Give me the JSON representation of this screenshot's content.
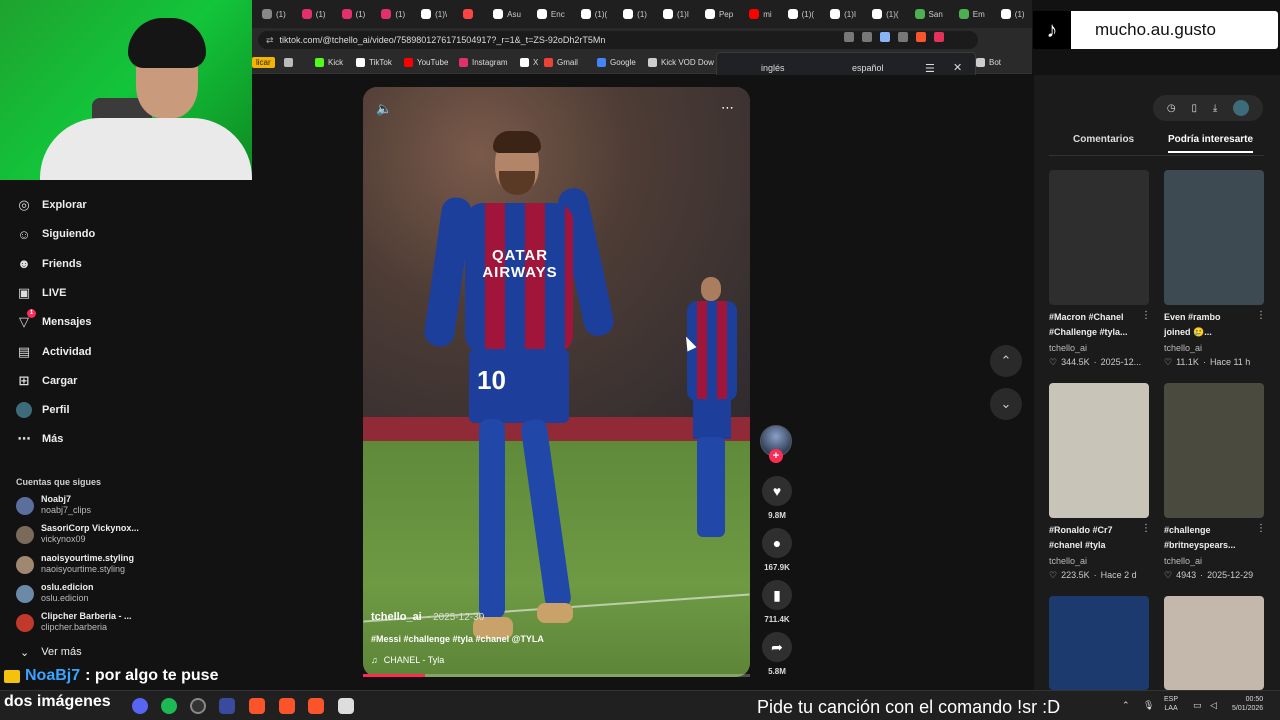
{
  "browser": {
    "tabs": [
      {
        "label": "(1)",
        "color": "#888888"
      },
      {
        "label": "(1)",
        "color": "#e1306c"
      },
      {
        "label": "(1)",
        "color": "#e1306c"
      },
      {
        "label": "(1)",
        "color": "#e1306c"
      },
      {
        "label": "(1)\\",
        "color": "#ffffff"
      },
      {
        "label": "",
        "color": "#ff4444"
      },
      {
        "label": "Asu",
        "color": "#ffffff"
      },
      {
        "label": "Enc",
        "color": "#ffffff"
      },
      {
        "label": "(1)(",
        "color": "#ffffff"
      },
      {
        "label": "(1)",
        "color": "#ffffff"
      },
      {
        "label": "(1)I",
        "color": "#ffffff"
      },
      {
        "label": "Pep",
        "color": "#ffffff"
      },
      {
        "label": "mi",
        "color": "#ff0000"
      },
      {
        "label": "(1)(",
        "color": "#ffffff"
      },
      {
        "label": "(1)I",
        "color": "#ffffff"
      },
      {
        "label": "(1)(",
        "color": "#ffffff"
      },
      {
        "label": "San",
        "color": "#4caf50"
      },
      {
        "label": "Em",
        "color": "#4caf50"
      },
      {
        "label": "(1)",
        "color": "#ffffff"
      }
    ],
    "url": "tiktok.com/@tchello_ai/video/7589801276171504917?_r=1&_t=ZS-92oDh2rT5Mn",
    "bookmarks": [
      {
        "label": "licar",
        "color": "#f5b400"
      },
      {
        "label": "",
        "color": "#bbbbbb"
      },
      {
        "label": "Kick",
        "color": "#53fc18"
      },
      {
        "label": "TikTok",
        "color": "#ffffff"
      },
      {
        "label": "YouTube",
        "color": "#ff0000"
      },
      {
        "label": "Instagram",
        "color": "#e1306c"
      },
      {
        "label": "X",
        "color": "#ffffff"
      },
      {
        "label": "Gmail",
        "color": "#ea4335"
      },
      {
        "label": "Google",
        "color": "#4285f4"
      },
      {
        "label": "Kick VOD Dow",
        "color": "#cccccc"
      },
      {
        "label": "Bot",
        "color": "#cccccc"
      }
    ],
    "translate": {
      "from": "inglés",
      "to": "español"
    }
  },
  "sidebar": {
    "nav": [
      {
        "label": "Explorar",
        "icon": "compass-icon",
        "glyph": "◎"
      },
      {
        "label": "Siguiendo",
        "icon": "following-icon",
        "glyph": "☺"
      },
      {
        "label": "Friends",
        "icon": "friends-icon",
        "glyph": "☻"
      },
      {
        "label": "LIVE",
        "icon": "live-icon",
        "glyph": "▣"
      },
      {
        "label": "Mensajes",
        "icon": "messages-icon",
        "glyph": "▽"
      },
      {
        "label": "Actividad",
        "icon": "activity-icon",
        "glyph": "▤"
      },
      {
        "label": "Cargar",
        "icon": "upload-icon",
        "glyph": "⊞"
      },
      {
        "label": "Perfil",
        "icon": "profile-icon",
        "glyph": "●"
      },
      {
        "label": "Más",
        "icon": "more-icon",
        "glyph": "⋯"
      }
    ],
    "messages_badge": "1",
    "following_header": "Cuentas que sigues",
    "accounts": [
      {
        "name": "Noabj7",
        "handle": "noabj7_clips",
        "color": "#5b6f9e"
      },
      {
        "name": "SasoriCorp Vickynox...",
        "handle": "vickynox09",
        "color": "#7a6a5a"
      },
      {
        "name": "naoisyourtime.styling",
        "handle": "naoisyourtime.styling",
        "color": "#a08870"
      },
      {
        "name": "oslu.edicion",
        "handle": "oslu.edicion",
        "color": "#6a8aa8"
      },
      {
        "name": "Clipcher Barberia - ...",
        "handle": "clipcher.barberia",
        "color": "#c0392b"
      }
    ],
    "see_more": "Ver más"
  },
  "video": {
    "username": "tchello_ai",
    "date": "· 2025-12-30",
    "tags": "#Messi #challenge #tyla #chanel @TYLA",
    "sound": "CHANEL - Tyla",
    "sponsor": "QATAR AIRWAYS",
    "number": "10",
    "progress_pct": 16
  },
  "actions": {
    "likes": "9.8M",
    "comments": "167.9K",
    "saves": "711.4K",
    "shares": "5.8M"
  },
  "right_panel": {
    "tabs": [
      "Comentarios",
      "Podría interesarte"
    ],
    "cards": [
      {
        "title1": "#Macron #Chanel",
        "title2": "#Challenge #tyla...",
        "user": "tchello_ai",
        "likes": "344.5K",
        "date": "2025-12...",
        "bg": "#2e2e2e"
      },
      {
        "title1": "Even #rambo",
        "title2": "joined 🥲...",
        "user": "tchello_ai",
        "likes": "11.1K",
        "date": "Hace 11 h",
        "bg": "#3e4a52"
      },
      {
        "title1": "#Ronaldo #Cr7",
        "title2": "#chanel #tyla",
        "user": "tchello_ai",
        "likes": "223.5K",
        "date": "Hace 2 d",
        "bg": "#c9c4b8"
      },
      {
        "title1": "#challenge",
        "title2": "#britneyspears...",
        "user": "tchello_ai",
        "likes": "4943",
        "date": "2025-12-29",
        "bg": "#4a4a3e"
      },
      {
        "title1": "",
        "title2": "",
        "user": "",
        "likes": "",
        "date": "",
        "bg": "#1d3a6e"
      },
      {
        "title1": "",
        "title2": "",
        "user": "",
        "likes": "",
        "date": "",
        "bg": "#c4b8ac"
      }
    ]
  },
  "overlay": {
    "tiktok_handle": "mucho.au.gusto",
    "chat_name": "NoaBj7",
    "chat_text": ": por algo te puse",
    "chat_text2": "dos imágenes",
    "song_request": "Pide tu canción con el comando !sr :D"
  },
  "taskbar": {
    "lang1": "ESP",
    "lang2": "LAA",
    "time": "00:50",
    "date": "5/01/2026"
  }
}
